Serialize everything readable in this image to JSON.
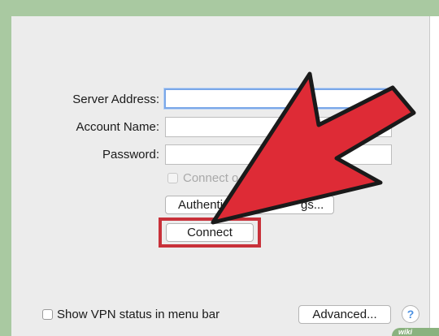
{
  "form": {
    "server_address_label": "Server Address:",
    "server_address_value": "",
    "account_name_label": "Account Name:",
    "account_name_value": "",
    "password_label": "Password:",
    "password_value": "",
    "connect_on_demand_label": "Connect o",
    "authentication_label": "Authenti",
    "authentication_label_tail": "gs...",
    "connect_label": "Connect"
  },
  "footer": {
    "show_vpn_status_label": "Show VPN status in menu bar",
    "advanced_label": "Advanced...",
    "help_label": "?"
  },
  "annotation": {
    "arrow_color": "#de2b36",
    "highlight_color": "#c8313a",
    "watermark_text": "wiki"
  },
  "colors": {
    "frame_green": "#a9c9a1",
    "panel_gray": "#ececec",
    "focus_blue": "#7aa7e8"
  }
}
